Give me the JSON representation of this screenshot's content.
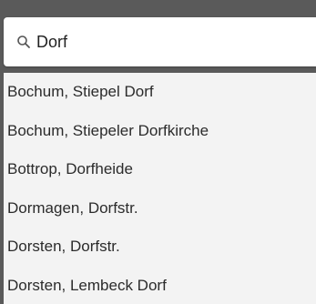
{
  "search": {
    "value": "Dorf",
    "icon": "search-icon"
  },
  "results": [
    "Bochum, Stiepel Dorf",
    "Bochum, Stiepeler Dorfkirche",
    "Bottrop, Dorfheide",
    "Dormagen, Dorfstr.",
    "Dorsten, Dorfstr.",
    "Dorsten, Lembeck Dorf"
  ],
  "colors": {
    "background": "#5a5a5a",
    "input_background": "#ffffff",
    "list_background": "#f3f3f3",
    "text": "#2b2b2b"
  }
}
